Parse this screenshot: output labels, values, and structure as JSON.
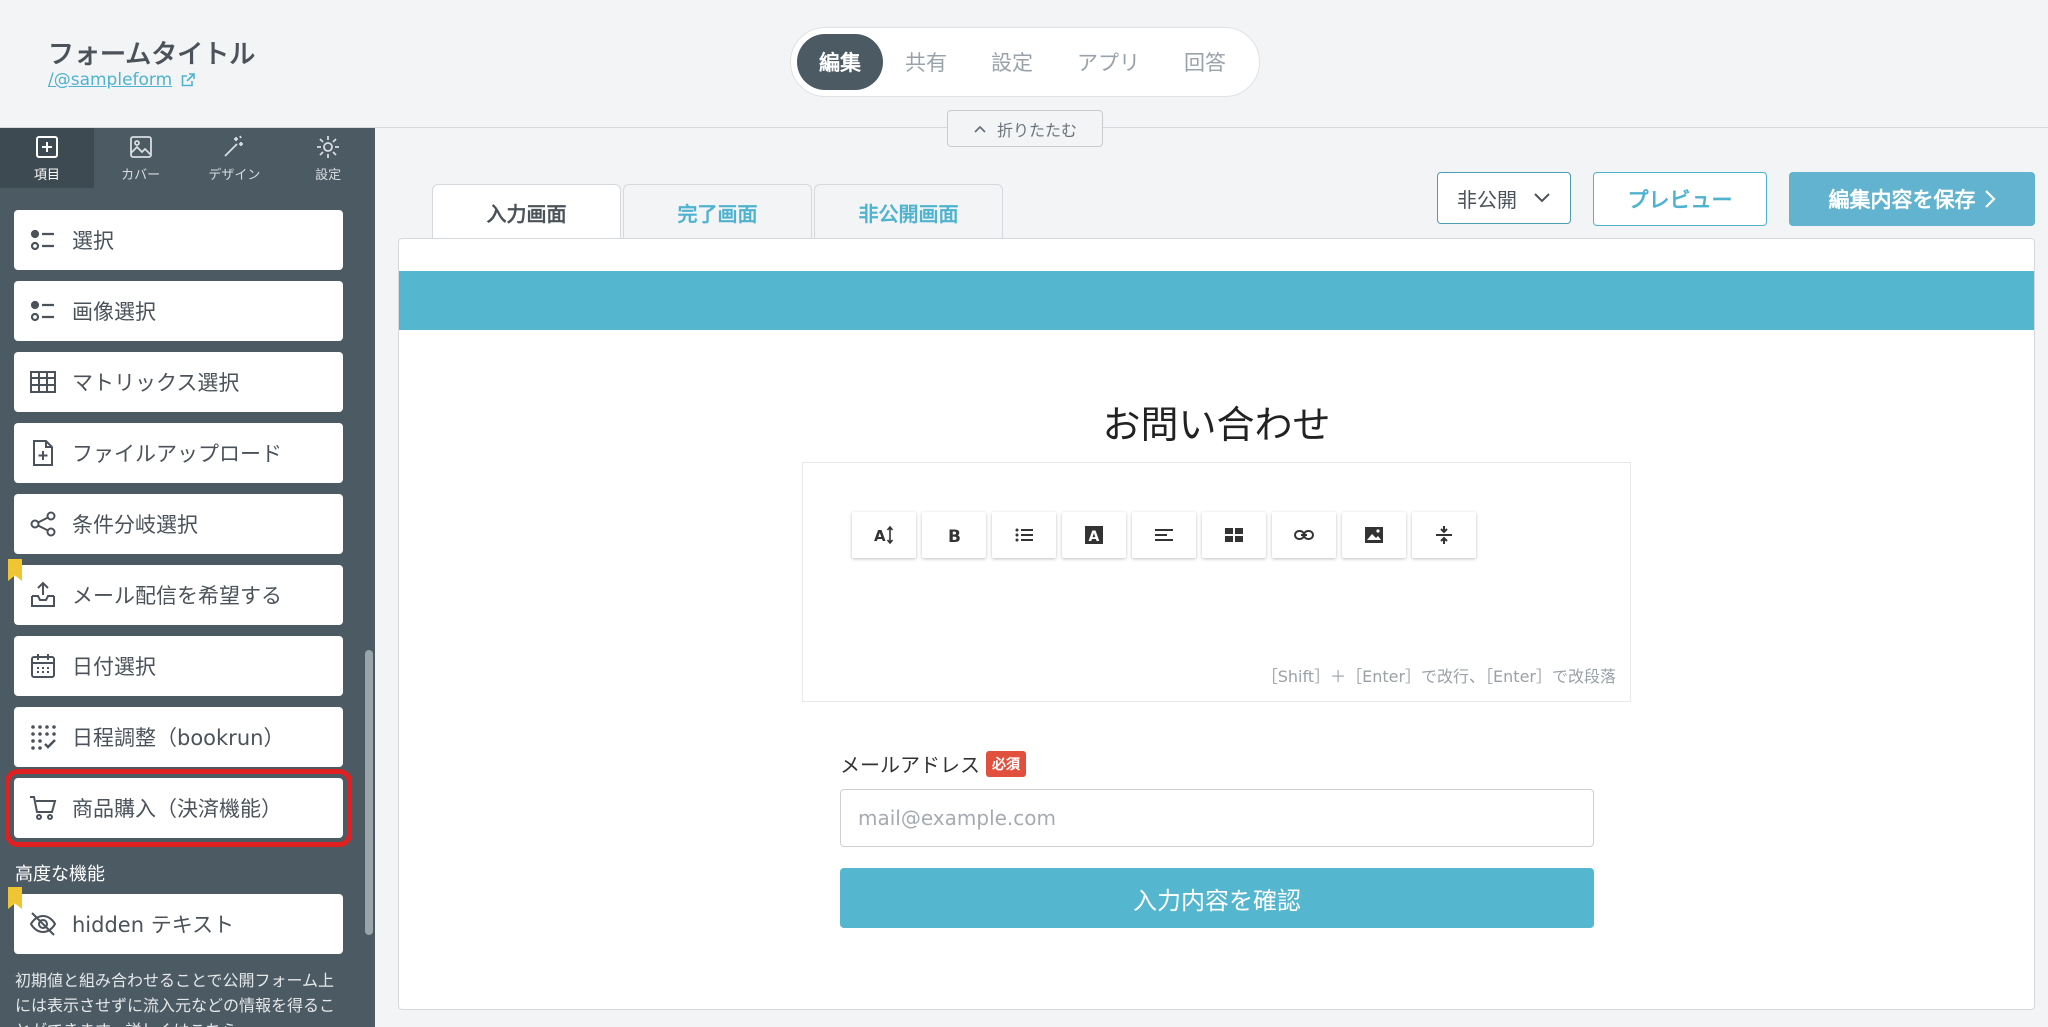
{
  "header": {
    "form_title": "フォームタイトル",
    "form_link": "/@sampleform",
    "mode_tabs": [
      {
        "label": "編集",
        "active": true
      },
      {
        "label": "共有",
        "active": false
      },
      {
        "label": "設定",
        "active": false
      },
      {
        "label": "アプリ",
        "active": false
      },
      {
        "label": "回答",
        "active": false
      }
    ],
    "collapse_label": "折りたたむ"
  },
  "sidebar": {
    "tabs": [
      {
        "label": "項目",
        "icon": "plus-square-icon",
        "active": true
      },
      {
        "label": "カバー",
        "icon": "image-icon",
        "active": false
      },
      {
        "label": "デザイン",
        "icon": "magic-wand-icon",
        "active": false
      },
      {
        "label": "設定",
        "icon": "gear-icon",
        "active": false
      }
    ],
    "items": [
      {
        "label": "選択",
        "icon": "list-icon"
      },
      {
        "label": "画像選択",
        "icon": "list-icon"
      },
      {
        "label": "マトリックス選択",
        "icon": "table-icon"
      },
      {
        "label": "ファイルアップロード",
        "icon": "file-plus-icon"
      },
      {
        "label": "条件分岐選択",
        "icon": "share-icon"
      },
      {
        "label": "メール配信を希望する",
        "icon": "inbox-upload-icon"
      },
      {
        "label": "日付選択",
        "icon": "calendar-icon"
      },
      {
        "label": "日程調整（bookrun）",
        "icon": "dot-grid-check-icon"
      },
      {
        "label": "商品購入（決済機能）",
        "icon": "cart-icon"
      }
    ],
    "section_label": "高度な機能",
    "advanced_items": [
      {
        "label": "hidden テキスト",
        "icon": "eye-off-icon"
      }
    ],
    "help_text": "初期値と組み合わせることで公開フォーム上には表示させずに流入元などの情報を得ることができます。詳しくはこちら"
  },
  "main": {
    "page_tabs": [
      {
        "label": "入力画面",
        "active": true
      },
      {
        "label": "完了画面",
        "active": false
      },
      {
        "label": "非公開画面",
        "active": false
      }
    ],
    "visibility": "非公開",
    "preview_label": "プレビュー",
    "save_label": "編集内容を保存",
    "form_heading": "お問い合わせ",
    "editor_hint": "［Shift］＋［Enter］で改行、［Enter］で改段落",
    "email_label": "メールアドレス",
    "required_label": "必須",
    "email_placeholder": "mail@example.com",
    "confirm_label": "入力内容を確認"
  },
  "colors": {
    "accent": "#55b6d0",
    "sidebar_bg": "#4c5a63",
    "highlight": "#e02020",
    "required": "#e0503c"
  }
}
